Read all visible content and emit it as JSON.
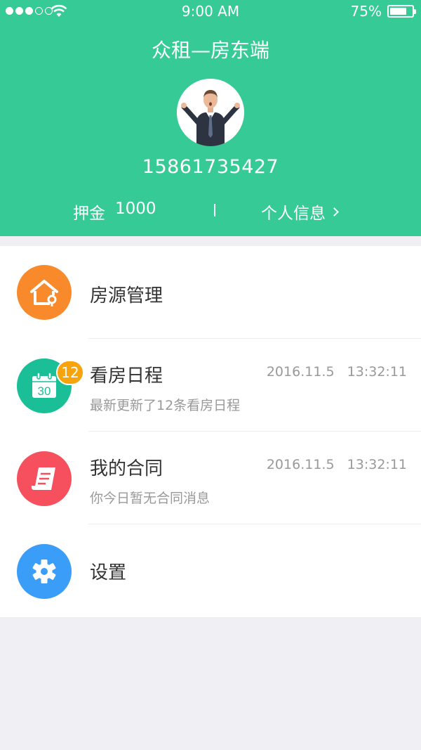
{
  "status_bar": {
    "time": "9:00 AM",
    "battery_percent": "75%",
    "battery_level": 0.75,
    "signal_bars": 3
  },
  "header": {
    "title": "众租—房东端",
    "phone": "15861735427",
    "deposit_label": "押金",
    "deposit_value": "1000",
    "profile_link": "个人信息"
  },
  "menu": {
    "property": {
      "title": "房源管理",
      "icon": "house-icon",
      "color": "#f98a2b"
    },
    "schedule": {
      "title": "看房日程",
      "subtitle": "最新更新了12条看房日程",
      "time": "2016.11.5   13:32:11",
      "badge": "12",
      "icon_day": "30",
      "icon": "calendar-icon",
      "color": "#1bbf97"
    },
    "contract": {
      "title": "我的合同",
      "subtitle": "你今日暂无合同消息",
      "time": "2016.11.5   13:32:11",
      "icon": "contract-icon",
      "color": "#f6505f"
    },
    "settings": {
      "title": "设置",
      "icon": "gear-icon",
      "color": "#3a9df7"
    }
  },
  "colors": {
    "header_bg": "#36cb96",
    "page_bg": "#efeff4",
    "badge": "#f7a30c"
  }
}
